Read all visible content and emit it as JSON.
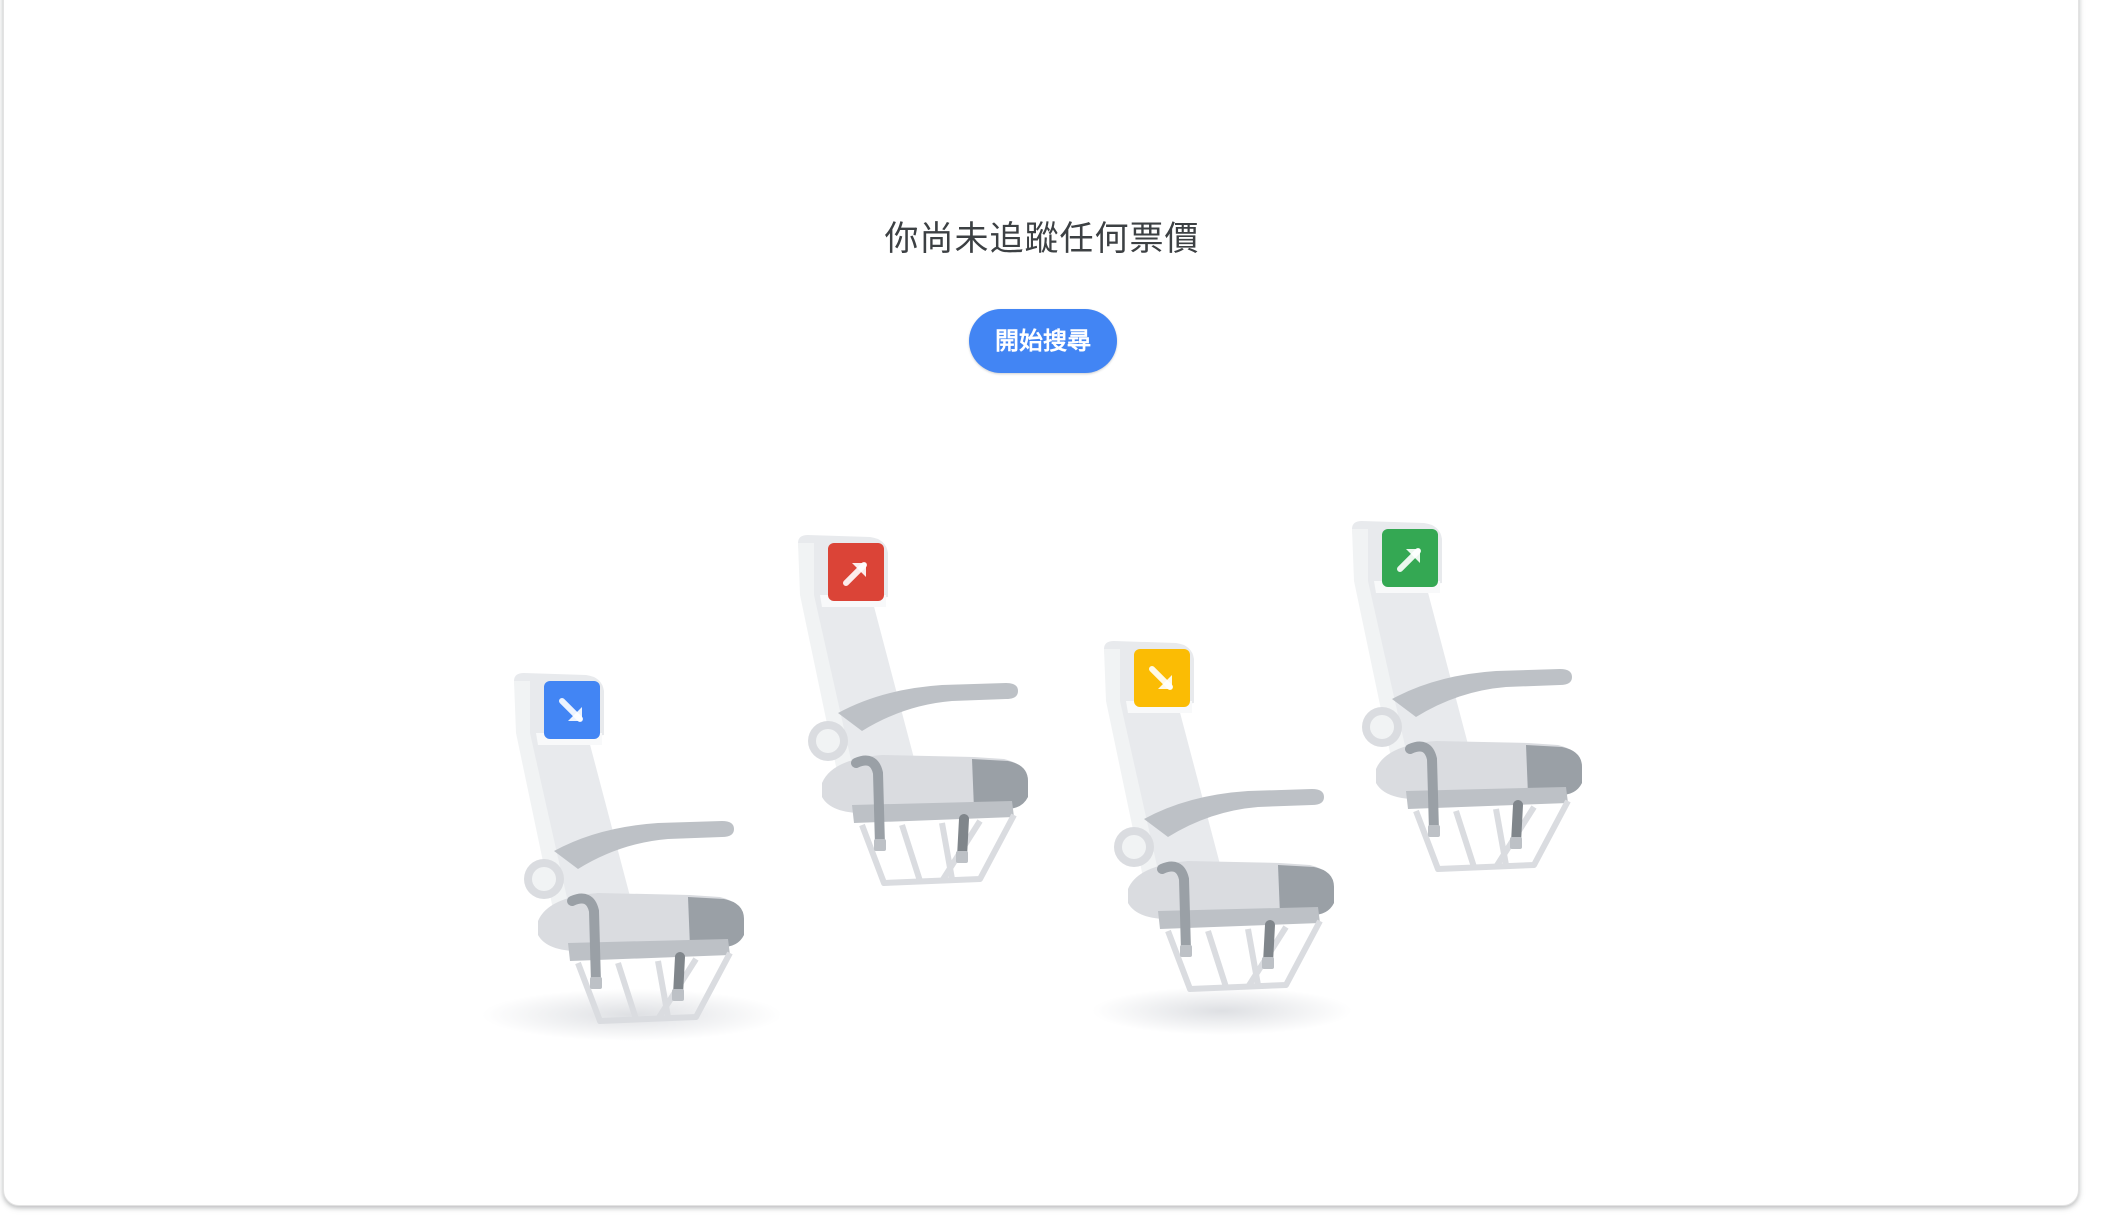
{
  "empty_state": {
    "title": "你尚未追蹤任何票價",
    "button_label": "開始搜尋"
  },
  "illustration": {
    "seats": [
      {
        "icon": "arrow-down-right-icon",
        "color": "#4285f4"
      },
      {
        "icon": "arrow-up-right-icon",
        "color": "#db4437"
      },
      {
        "icon": "arrow-down-right-icon",
        "color": "#fbbc04"
      },
      {
        "icon": "arrow-up-right-icon",
        "color": "#34a853"
      }
    ]
  }
}
